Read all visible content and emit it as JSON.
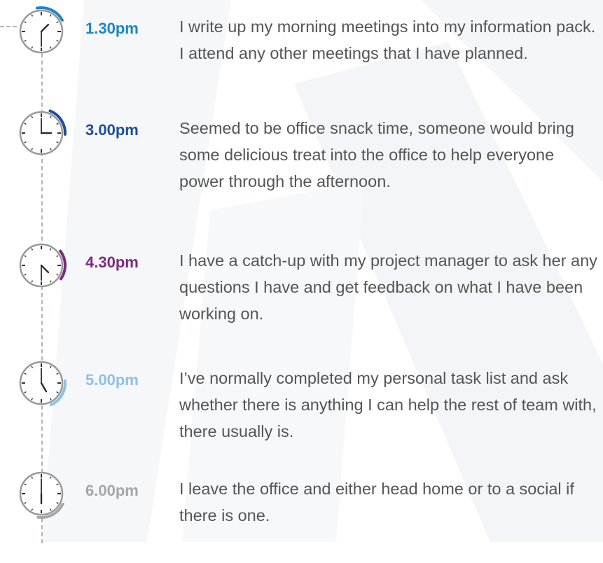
{
  "colors": {
    "text": "#555555",
    "divider": "#b5b5b5",
    "clock_face": "#ffffff",
    "clock_ring": "#999999"
  },
  "entries": [
    {
      "time": "1.30pm",
      "accent": "#1a87c9",
      "icon": "clock-icon",
      "text": "I write up my morning meetings into my information pack. I attend any other meetings that I have planned."
    },
    {
      "time": "3.00pm",
      "accent": "#1c4f9c",
      "icon": "clock-icon",
      "text": "Seemed to be office snack time, someone would bring some delicious treat into the office to help everyone power through the afternoon."
    },
    {
      "time": "4.30pm",
      "accent": "#7e2b7f",
      "icon": "clock-icon",
      "text": "I have a catch-up with my project manager to ask her any questions I have and get feedback on what I have been working on."
    },
    {
      "time": "5.00pm",
      "accent": "#8cc2e6",
      "icon": "clock-icon",
      "text": "I’ve normally completed my personal task list and ask whether there is anything I can help the rest of team with, there usually is."
    },
    {
      "time": "6.00pm",
      "accent": "#a6a6a6",
      "icon": "clock-icon",
      "text": "I leave the office and either head home or to a social if there is one."
    }
  ]
}
